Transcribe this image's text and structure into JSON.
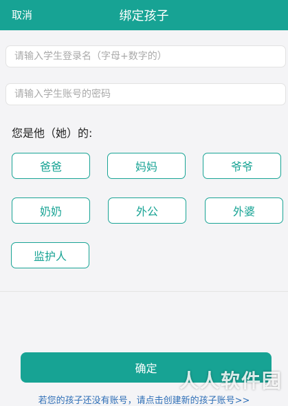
{
  "header": {
    "cancel_label": "取消",
    "title": "绑定孩子"
  },
  "form": {
    "username_placeholder": "请输入学生登录名（字母+数字的）",
    "password_placeholder": "请输入学生账号的密码"
  },
  "relation": {
    "question": "您是他（她）的:",
    "options": [
      "爸爸",
      "妈妈",
      "爷爷",
      "奶奶",
      "外公",
      "外婆",
      "监护人"
    ]
  },
  "actions": {
    "confirm_label": "确定",
    "create_link": "若您的孩子还没有账号，请点击创建新的孩子账号>>"
  },
  "watermark": "人人软件园",
  "colors": {
    "accent": "#17a394",
    "link": "#2f6fb7"
  }
}
